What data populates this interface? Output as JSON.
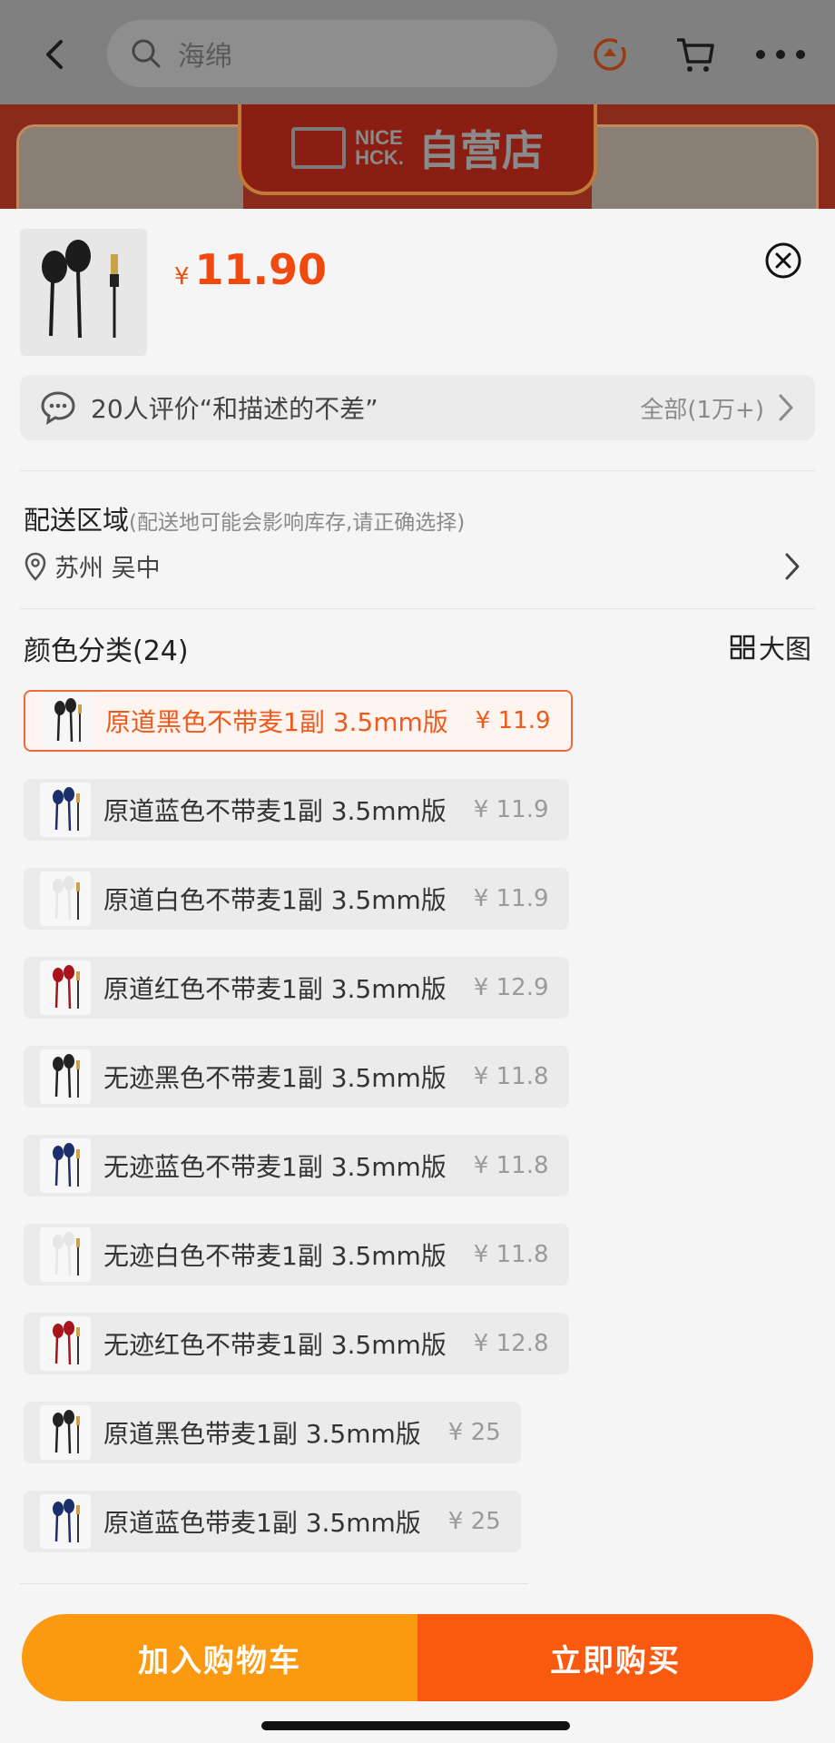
{
  "header": {
    "search_placeholder": "海绵",
    "icons": [
      "back-arrow-icon",
      "search-icon",
      "refresh-icon",
      "cart-icon",
      "more-icon"
    ]
  },
  "store_banner": {
    "logo_line1": "NICE",
    "logo_line2": "HCK.",
    "shop_type": "自营店"
  },
  "product": {
    "currency": "¥",
    "price": "11.90"
  },
  "review": {
    "text": "20人评价“和描述的不差”",
    "all_label": "全部(1万+)"
  },
  "delivery": {
    "title": "配送区域",
    "hint": "(配送地可能会影响库存,请正确选择)",
    "location": "苏州 吴中"
  },
  "color": {
    "title": "颜色分类(24)",
    "big_view_label": "大图",
    "options": [
      {
        "name": "原道黑色不带麦1副 3.5mm版",
        "price": "¥ 11.9",
        "selected": true,
        "color": "#222222"
      },
      {
        "name": "原道蓝色不带麦1副 3.5mm版",
        "price": "¥ 11.9",
        "selected": false,
        "color": "#1d2f6a"
      },
      {
        "name": "原道白色不带麦1副 3.5mm版",
        "price": "¥ 11.9",
        "selected": false,
        "color": "#e6e6e6"
      },
      {
        "name": "原道红色不带麦1副 3.5mm版",
        "price": "¥ 12.9",
        "selected": false,
        "color": "#a8141c"
      },
      {
        "name": "无迹黑色不带麦1副 3.5mm版",
        "price": "¥ 11.8",
        "selected": false,
        "color": "#222222"
      },
      {
        "name": "无迹蓝色不带麦1副 3.5mm版",
        "price": "¥ 11.8",
        "selected": false,
        "color": "#1d2f6a"
      },
      {
        "name": "无迹白色不带麦1副 3.5mm版",
        "price": "¥ 11.8",
        "selected": false,
        "color": "#e6e6e6"
      },
      {
        "name": "无迹红色不带麦1副 3.5mm版",
        "price": "¥ 12.8",
        "selected": false,
        "color": "#a8141c"
      },
      {
        "name": "原道黑色带麦1副 3.5mm版",
        "price": "¥ 25",
        "selected": false,
        "color": "#222222"
      },
      {
        "name": "原道蓝色带麦1副 3.5mm版",
        "price": "¥ 25",
        "selected": false,
        "color": "#1d2f6a"
      }
    ]
  },
  "actions": {
    "add_to_cart": "加入购物车",
    "buy_now": "立即购买"
  },
  "colors": {
    "accent": "#f04a10",
    "cart_button": "#fb9a10",
    "buy_button": "#fa5a10"
  }
}
